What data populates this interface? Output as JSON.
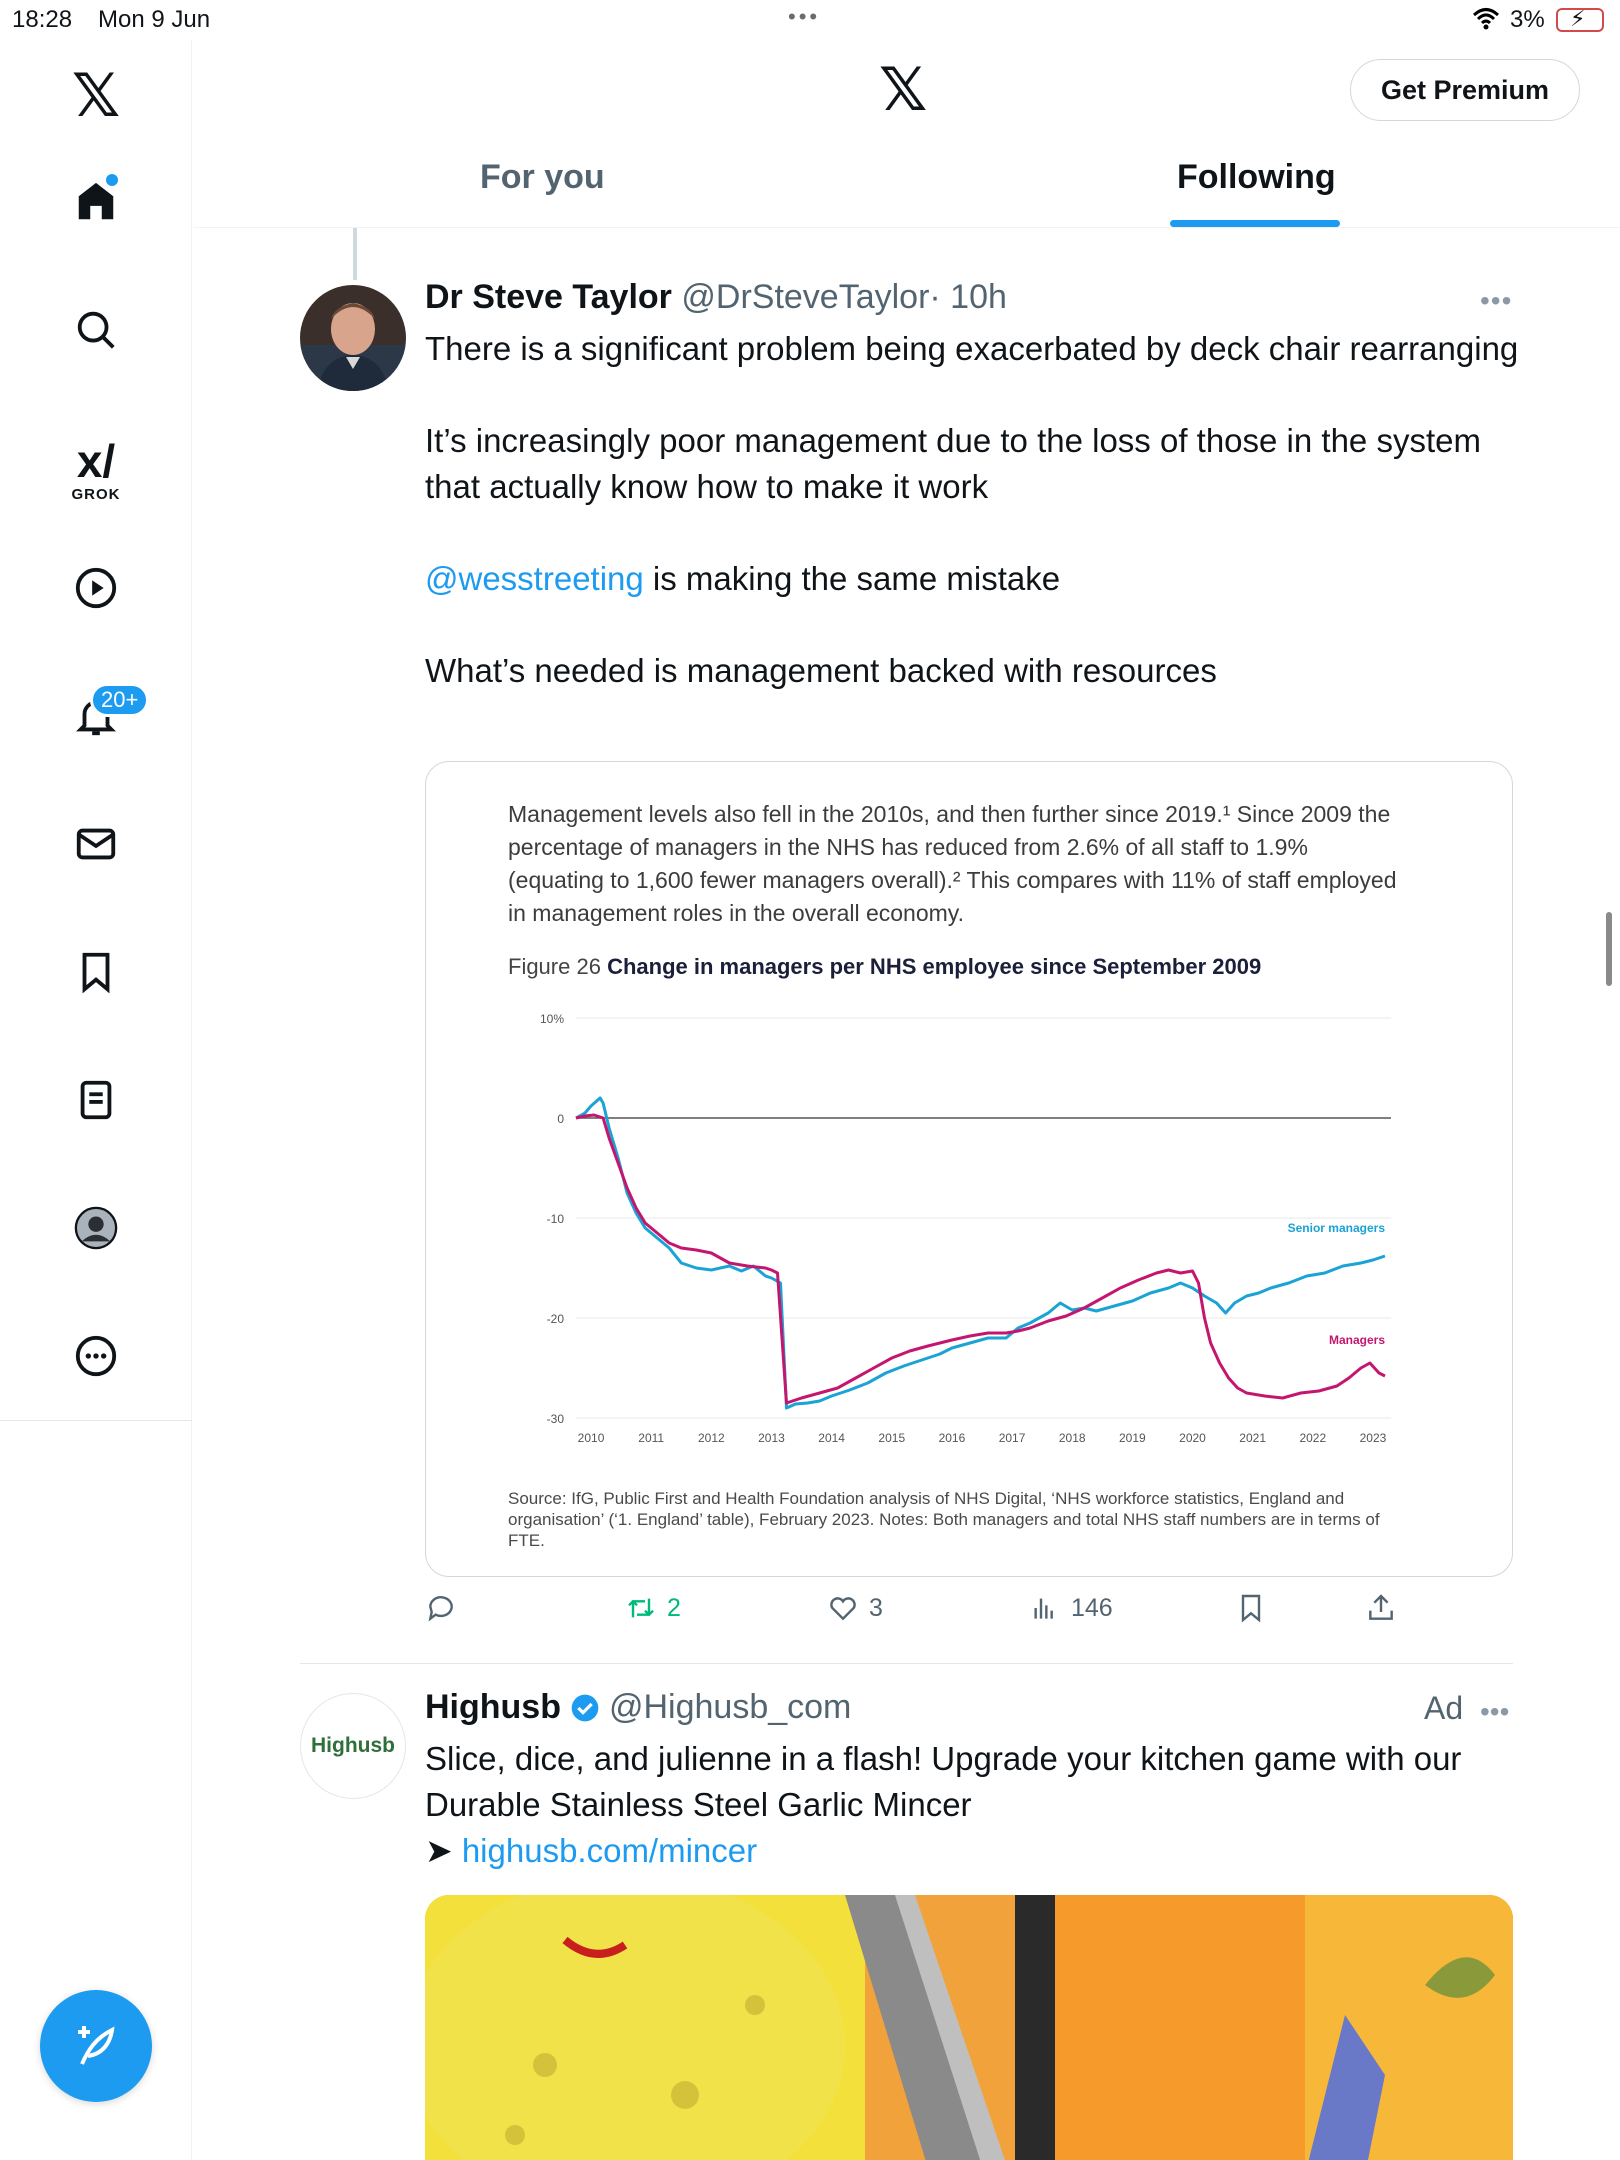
{
  "status_bar": {
    "time": "18:28",
    "date": "Mon 9 Jun",
    "battery": "3%"
  },
  "sidebar": {
    "grok_label": "GROK",
    "notification_badge": "20+",
    "items": [
      "home-icon",
      "search-icon",
      "grok-icon",
      "video-icon",
      "notifications-icon",
      "messages-icon",
      "bookmarks-icon",
      "lists-icon",
      "profile-icon",
      "more-icon"
    ]
  },
  "header": {
    "logo": "X",
    "premium_button": "Get Premium",
    "tabs": [
      {
        "label": "For you",
        "active": false
      },
      {
        "label": "Following",
        "active": true
      }
    ]
  },
  "tweet": {
    "author_name": "Dr Steve Taylor",
    "author_handle": "@DrSteveTaylor",
    "time": "· 10h",
    "paragraphs": [
      "There is a significant problem being exacerbated by deck chair rearranging",
      "It’s increasingly poor management due to the loss of those in the system that actually know how to make it work"
    ],
    "mention": "@wesstreeting",
    "mention_rest": " is making the same mistake",
    "last_paragraph": "What’s needed is management backed with resources",
    "media": {
      "intro": "Management levels also fell in the 2010s, and then further since 2019.¹ Since 2009 the percentage of managers in the NHS has reduced from 2.6% of all staff to 1.9% (equating to 1,600 fewer managers overall).² This compares with 11% of staff employed in management roles in the overall economy.",
      "figure_number": "Figure 26",
      "figure_title": "Change in managers per NHS employee since September 2009",
      "source": "Source: IfG, Public First and Health Foundation analysis of NHS Digital, ‘NHS workforce statistics, England and organisation’ (‘1. England’ table), February 2023. Notes: Both managers and total NHS staff numbers are in terms of FTE."
    },
    "stats": {
      "replies": "",
      "reposts": "2",
      "likes": "3",
      "views": "146"
    }
  },
  "ad": {
    "author_name": "Highusb",
    "author_handle": "@Highusb_com",
    "ad_label": "Ad",
    "avatar_text": "Highusb",
    "text": "Slice, dice, and julienne in a flash! Upgrade your kitchen game with our Durable Stainless Steel Garlic Mincer",
    "arrow": "➤",
    "link": "highusb.com/mincer"
  },
  "colors": {
    "accent": "#1d9bf0",
    "repost": "#00ba7c",
    "senior_managers": "#1aa3d4",
    "managers": "#c4166f"
  },
  "chart_data": {
    "type": "line",
    "title": "Change in managers per NHS employee since September 2009",
    "ylim": [
      -30,
      10
    ],
    "yticks": [
      "10%",
      "0",
      "-10",
      "-20",
      "-30"
    ],
    "xticks": [
      "2010",
      "2011",
      "2012",
      "2013",
      "2014",
      "2015",
      "2016",
      "2017",
      "2018",
      "2019",
      "2020",
      "2021",
      "2022",
      "2023"
    ],
    "xlim": [
      2009.75,
      2023.3
    ],
    "series": [
      {
        "name": "Senior managers",
        "color": "#1aa3d4",
        "points": [
          [
            2009.75,
            0
          ],
          [
            2009.9,
            0.5
          ],
          [
            2010.0,
            1.2
          ],
          [
            2010.15,
            2
          ],
          [
            2010.2,
            1.5
          ],
          [
            2010.3,
            -1
          ],
          [
            2010.45,
            -4
          ],
          [
            2010.6,
            -7.5
          ],
          [
            2010.75,
            -9.5
          ],
          [
            2010.9,
            -11
          ],
          [
            2011.1,
            -12
          ],
          [
            2011.3,
            -13
          ],
          [
            2011.5,
            -14.5
          ],
          [
            2011.75,
            -15
          ],
          [
            2012.0,
            -15.2
          ],
          [
            2012.3,
            -14.8
          ],
          [
            2012.5,
            -15.3
          ],
          [
            2012.7,
            -14.8
          ],
          [
            2012.9,
            -15.8
          ],
          [
            2013.0,
            -16
          ],
          [
            2013.15,
            -16.5
          ],
          [
            2013.25,
            -29
          ],
          [
            2013.4,
            -28.6
          ],
          [
            2013.6,
            -28.5
          ],
          [
            2013.8,
            -28.3
          ],
          [
            2014.0,
            -27.8
          ],
          [
            2014.3,
            -27.2
          ],
          [
            2014.6,
            -26.5
          ],
          [
            2014.9,
            -25.5
          ],
          [
            2015.2,
            -24.8
          ],
          [
            2015.5,
            -24.2
          ],
          [
            2015.8,
            -23.6
          ],
          [
            2016.0,
            -23
          ],
          [
            2016.3,
            -22.5
          ],
          [
            2016.6,
            -22
          ],
          [
            2016.9,
            -22
          ],
          [
            2017.1,
            -21
          ],
          [
            2017.3,
            -20.5
          ],
          [
            2017.6,
            -19.5
          ],
          [
            2017.8,
            -18.5
          ],
          [
            2018.0,
            -19.2
          ],
          [
            2018.2,
            -19
          ],
          [
            2018.4,
            -19.3
          ],
          [
            2018.7,
            -18.8
          ],
          [
            2019.0,
            -18.3
          ],
          [
            2019.3,
            -17.5
          ],
          [
            2019.6,
            -17
          ],
          [
            2019.8,
            -16.5
          ],
          [
            2020.0,
            -17
          ],
          [
            2020.2,
            -17.8
          ],
          [
            2020.4,
            -18.5
          ],
          [
            2020.55,
            -19.5
          ],
          [
            2020.7,
            -18.5
          ],
          [
            2020.9,
            -17.8
          ],
          [
            2021.1,
            -17.5
          ],
          [
            2021.3,
            -17
          ],
          [
            2021.6,
            -16.5
          ],
          [
            2021.9,
            -15.8
          ],
          [
            2022.2,
            -15.5
          ],
          [
            2022.5,
            -14.8
          ],
          [
            2022.8,
            -14.5
          ],
          [
            2023.0,
            -14.2
          ],
          [
            2023.2,
            -13.8
          ]
        ]
      },
      {
        "name": "Managers",
        "color": "#c4166f",
        "points": [
          [
            2009.75,
            0
          ],
          [
            2009.9,
            0.2
          ],
          [
            2010.05,
            0.3
          ],
          [
            2010.2,
            0
          ],
          [
            2010.3,
            -2
          ],
          [
            2010.45,
            -4.5
          ],
          [
            2010.6,
            -7
          ],
          [
            2010.75,
            -9
          ],
          [
            2010.9,
            -10.5
          ],
          [
            2011.1,
            -11.5
          ],
          [
            2011.3,
            -12.5
          ],
          [
            2011.5,
            -13
          ],
          [
            2011.75,
            -13.2
          ],
          [
            2012.0,
            -13.5
          ],
          [
            2012.3,
            -14.5
          ],
          [
            2012.6,
            -14.8
          ],
          [
            2012.9,
            -15
          ],
          [
            2013.0,
            -15.2
          ],
          [
            2013.1,
            -15.5
          ],
          [
            2013.25,
            -28.5
          ],
          [
            2013.5,
            -28
          ],
          [
            2013.8,
            -27.5
          ],
          [
            2014.1,
            -27
          ],
          [
            2014.4,
            -26
          ],
          [
            2014.7,
            -25
          ],
          [
            2015.0,
            -24
          ],
          [
            2015.3,
            -23.3
          ],
          [
            2015.6,
            -22.8
          ],
          [
            2016.0,
            -22.2
          ],
          [
            2016.3,
            -21.8
          ],
          [
            2016.6,
            -21.5
          ],
          [
            2016.9,
            -21.5
          ],
          [
            2017.1,
            -21.3
          ],
          [
            2017.3,
            -21
          ],
          [
            2017.6,
            -20.3
          ],
          [
            2017.9,
            -19.8
          ],
          [
            2018.2,
            -19
          ],
          [
            2018.5,
            -18
          ],
          [
            2018.8,
            -17
          ],
          [
            2019.1,
            -16.2
          ],
          [
            2019.4,
            -15.5
          ],
          [
            2019.6,
            -15.2
          ],
          [
            2019.8,
            -15.5
          ],
          [
            2020.0,
            -15.3
          ],
          [
            2020.1,
            -16.5
          ],
          [
            2020.2,
            -20
          ],
          [
            2020.3,
            -22.5
          ],
          [
            2020.45,
            -24.5
          ],
          [
            2020.6,
            -26
          ],
          [
            2020.75,
            -27
          ],
          [
            2020.9,
            -27.5
          ],
          [
            2021.2,
            -27.8
          ],
          [
            2021.5,
            -28
          ],
          [
            2021.8,
            -27.5
          ],
          [
            2022.1,
            -27.3
          ],
          [
            2022.4,
            -26.8
          ],
          [
            2022.6,
            -26
          ],
          [
            2022.8,
            -25
          ],
          [
            2022.95,
            -24.5
          ],
          [
            2023.1,
            -25.5
          ],
          [
            2023.2,
            -25.8
          ]
        ]
      }
    ]
  }
}
